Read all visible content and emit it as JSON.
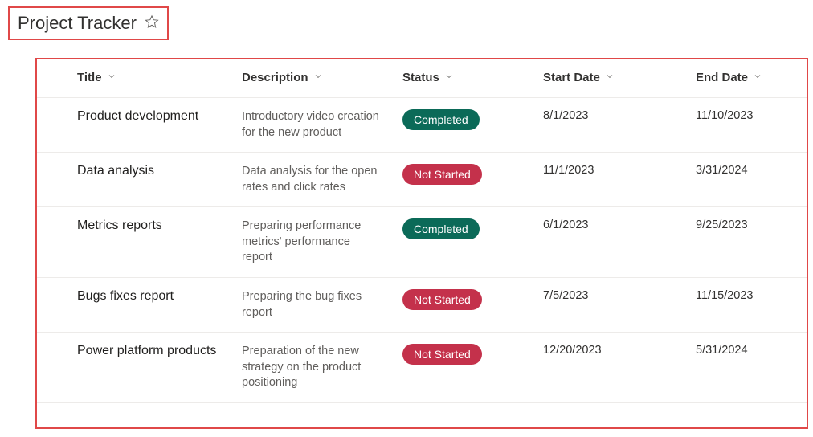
{
  "title": "Project Tracker",
  "columns": {
    "title": "Title",
    "description": "Description",
    "status": "Status",
    "start_date": "Start Date",
    "end_date": "End Date"
  },
  "status_styles": {
    "Completed": "status-completed",
    "Not Started": "status-notstarted"
  },
  "rows": [
    {
      "title": "Product development",
      "description": "Introductory video creation for the new product",
      "status": "Completed",
      "start_date": "8/1/2023",
      "end_date": "11/10/2023"
    },
    {
      "title": "Data analysis",
      "description": "Data analysis for the open rates and click rates",
      "status": "Not Started",
      "start_date": "11/1/2023",
      "end_date": "3/31/2024"
    },
    {
      "title": "Metrics reports",
      "description": "Preparing performance metrics' performance report",
      "status": "Completed",
      "start_date": "6/1/2023",
      "end_date": "9/25/2023"
    },
    {
      "title": "Bugs fixes report",
      "description": "Preparing the bug fixes report",
      "status": "Not Started",
      "start_date": "7/5/2023",
      "end_date": "11/15/2023"
    },
    {
      "title": "Power platform products",
      "description": "Preparation of the new strategy on the product positioning",
      "status": "Not Started",
      "start_date": "12/20/2023",
      "end_date": "5/31/2024"
    }
  ]
}
